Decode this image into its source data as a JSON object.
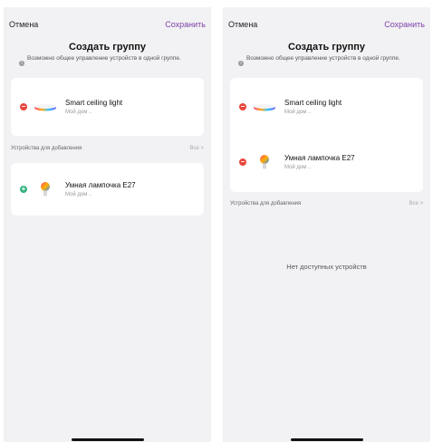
{
  "screens": [
    {
      "nav": {
        "cancel": "Отмена",
        "save": "Сохранить"
      },
      "title": "Создать группу",
      "hint": "Возможно общее управление устройств в одной группе.",
      "group_devices": [
        {
          "name": "Smart ceiling light",
          "home": "Мой дом ..",
          "icon": "ceiling-light-icon"
        }
      ],
      "section": {
        "label": "Устройства для добавления",
        "all": "Все >"
      },
      "available_devices": [
        {
          "name": "Умная лампочка E27",
          "home": "Мой дом ..",
          "icon": "bulb-icon"
        }
      ]
    },
    {
      "nav": {
        "cancel": "Отмена",
        "save": "Сохранить"
      },
      "title": "Создать группу",
      "hint": "Возможно общее управление устройств в одной группе.",
      "group_devices": [
        {
          "name": "Smart ceiling light",
          "home": "Мой дом ..",
          "icon": "ceiling-light-icon"
        },
        {
          "name": "Умная лампочка E27",
          "home": "Мой дом ..",
          "icon": "bulb-icon"
        }
      ],
      "section": {
        "label": "Устройства для добавления",
        "all": "Все >"
      },
      "empty_text": "Нет доступных устройств"
    }
  ],
  "colors": {
    "accent": "#7d3fa6",
    "remove": "#e8463c",
    "add": "#36b37e"
  }
}
